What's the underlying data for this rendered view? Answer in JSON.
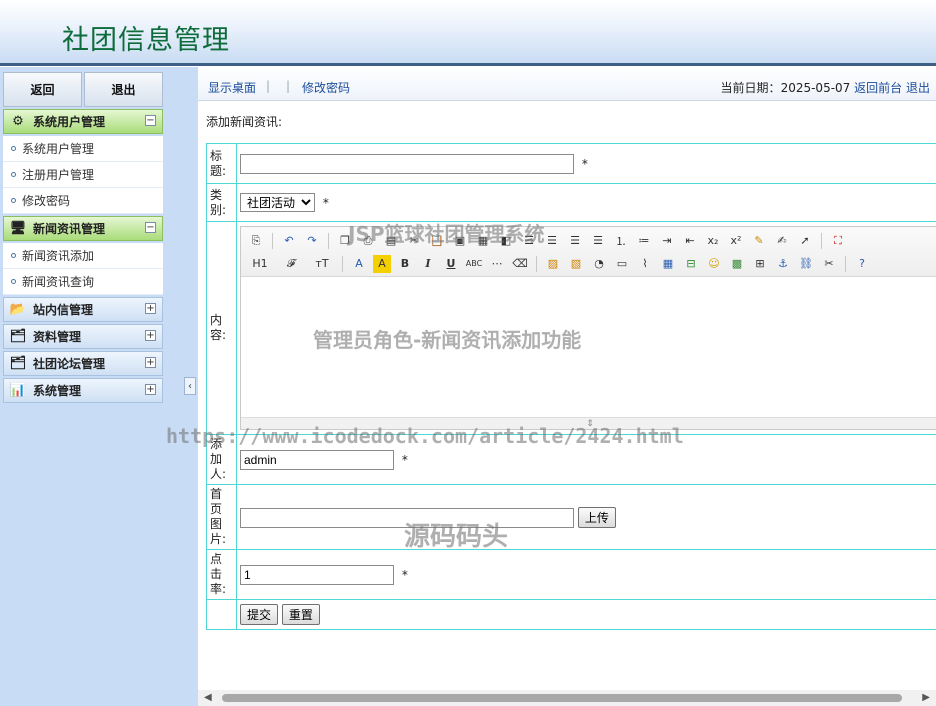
{
  "header": {
    "title": "社团信息管理"
  },
  "sidebar": {
    "top_buttons": {
      "back": "返回",
      "logout": "退出"
    },
    "groups": [
      {
        "label": "系统用户管理",
        "icon": "gear-icon",
        "expanded": true,
        "items": [
          "系统用户管理",
          "注册用户管理",
          "修改密码"
        ]
      },
      {
        "label": "新闻资讯管理",
        "icon": "monitor-icon",
        "expanded": true,
        "items": [
          "新闻资讯添加",
          "新闻资讯查询"
        ]
      },
      {
        "label": "站内信管理",
        "icon": "folder-icon",
        "expanded": false,
        "items": []
      },
      {
        "label": "资料管理",
        "icon": "documents-icon",
        "expanded": false,
        "items": []
      },
      {
        "label": "社团论坛管理",
        "icon": "documents-icon",
        "expanded": false,
        "items": []
      },
      {
        "label": "系统管理",
        "icon": "bar-chart-icon",
        "expanded": false,
        "items": []
      }
    ],
    "collapse_glyph": "‹"
  },
  "topbar": {
    "show_desktop": "显示桌面",
    "change_password": "修改密码",
    "date_label": "当前日期：",
    "date_value": "2025-05-07",
    "back_front": "返回前台",
    "logout": "退出"
  },
  "form": {
    "caption": "添加新闻资讯:",
    "title_label": "标题:",
    "title_value": "",
    "category_label": "类别:",
    "category_value": "社团活动",
    "content_label": "内容:",
    "author_label": "添加人:",
    "author_value": "admin",
    "image_label": "首页图片:",
    "image_value": "",
    "upload_button": "上传",
    "clicks_label": "点击率:",
    "clicks_value": "1",
    "required_mark": "*",
    "submit_button": "提交",
    "reset_button": "重置"
  },
  "editor_toolbar": {
    "row1": [
      "source-icon",
      "undo-icon",
      "redo-icon",
      "sep",
      "copy-icon",
      "cut-icon",
      "paste-icon",
      "paste-text-icon",
      "paste-word-icon",
      "find-icon",
      "replace-icon",
      "sep2",
      "align-left-icon",
      "align-center-icon",
      "align-right-icon",
      "align-justify-icon",
      "ordered-list-icon",
      "unordered-list-icon",
      "indent-icon",
      "outdent-icon",
      "subscript-icon",
      "superscript-icon",
      "clear-format-icon",
      "select-all-icon",
      "pointer-icon",
      "sep3",
      "fullscreen-icon"
    ],
    "heading": "H1",
    "font_name": "𝓕",
    "font_size": "тT",
    "row2": [
      "font-color-icon",
      "highlight-icon",
      "bold-icon",
      "italic-icon",
      "underline-icon",
      "strikethrough-icon",
      "hr-icon",
      "eraser-icon",
      "sep",
      "image-icon",
      "multi-image-icon",
      "flash-icon",
      "media-icon",
      "attachment-icon",
      "table-icon",
      "insert-hr-icon",
      "emoticon-icon",
      "map-icon",
      "pagebreak-icon",
      "anchor-icon",
      "link-icon",
      "unlink-icon",
      "sep2",
      "help-icon"
    ]
  },
  "watermarks": {
    "system_name": "JSP篮球社团管理系统",
    "feature": "管理员角色-新闻资讯添加功能",
    "url": "https://www.icodedock.com/article/2424.html",
    "brand": "源码码头"
  }
}
